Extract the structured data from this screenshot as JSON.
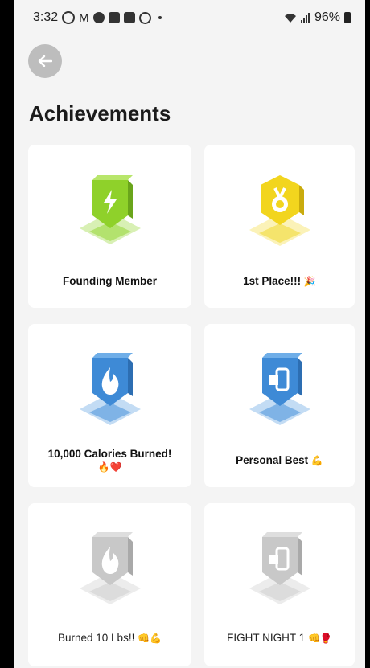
{
  "status_bar": {
    "time": "3:32",
    "battery": "96%",
    "left_icons": [
      "whatsapp-icon",
      "gmail-icon",
      "messenger-icon",
      "linkedin-icon",
      "qr-icon",
      "drive-icon"
    ],
    "right_icons": [
      "wifi-icon",
      "signal-icon",
      "battery-icon"
    ]
  },
  "page": {
    "title": "Achievements",
    "back_icon": "arrow-left-icon"
  },
  "achievements": [
    {
      "label": "Founding Member",
      "emoji": "",
      "icon": "lightning-icon",
      "color": "#8fd12a",
      "locked": false
    },
    {
      "label": "1st Place!!!",
      "emoji": "🎉",
      "icon": "medal-icon",
      "color": "#f2d51e",
      "locked": false
    },
    {
      "label": "10,000 Calories Burned!",
      "emoji": "🔥❤️",
      "icon": "flame-icon",
      "color": "#3e8ad6",
      "locked": false
    },
    {
      "label": "Personal Best",
      "emoji": "💪",
      "icon": "phone-hand-icon",
      "color": "#3e8ad6",
      "locked": false
    },
    {
      "label": "Burned 10 Lbs!!",
      "emoji": "👊💪",
      "icon": "flame-icon",
      "color": "#c8c8c8",
      "locked": true
    },
    {
      "label": "FIGHT NIGHT 1",
      "emoji": "👊🥊",
      "icon": "phone-hand-icon",
      "color": "#c8c8c8",
      "locked": true
    }
  ]
}
